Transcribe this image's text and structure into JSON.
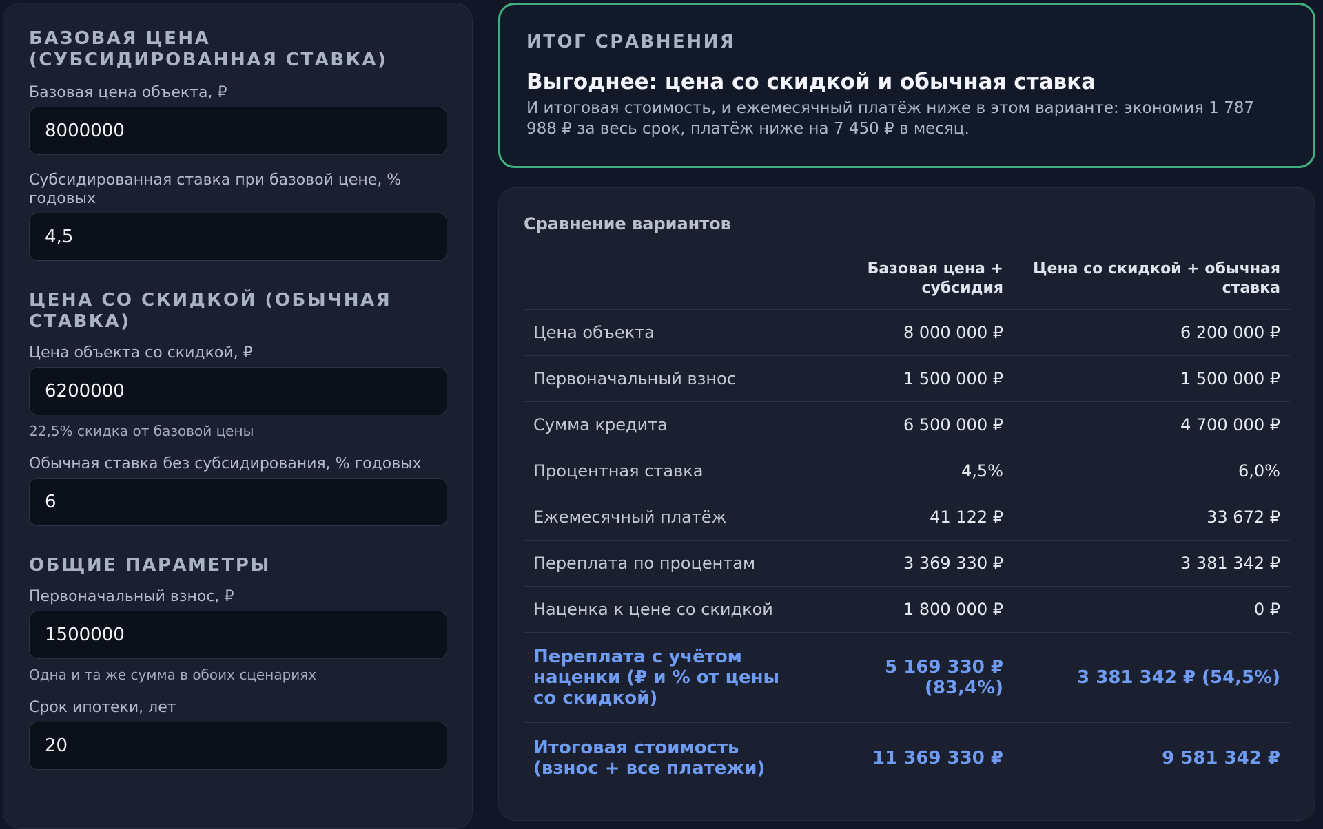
{
  "left": {
    "base_section_title": "БАЗОВАЯ ЦЕНА (СУБСИДИРОВАННАЯ СТАВКА)",
    "base_price_label": "Базовая цена объекта, ₽",
    "base_price_value": "8000000",
    "subsidized_rate_label": "Субсидированная ставка при базовой цене, % годовых",
    "subsidized_rate_value": "4,5",
    "discount_section_title": "ЦЕНА СО СКИДКОЙ (ОБЫЧНАЯ СТАВКА)",
    "discount_price_label": "Цена объекта со скидкой, ₽",
    "discount_price_value": "6200000",
    "discount_hint": "22,5% скидка от базовой цены",
    "regular_rate_label": "Обычная ставка без субсидирования, % годовых",
    "regular_rate_value": "6",
    "common_section_title": "ОБЩИЕ ПАРАМЕТРЫ",
    "down_payment_label": "Первоначальный взнос, ₽",
    "down_payment_value": "1500000",
    "down_payment_hint": "Одна и та же сумма в обоих сценариях",
    "term_label": "Срок ипотеки, лет",
    "term_value": "20"
  },
  "summary": {
    "heading": "ИТОГ СРАВНЕНИЯ",
    "verdict": "Выгоднее: цена со скидкой и обычная ставка",
    "text": "И итоговая стоимость, и ежемесячный платёж ниже в этом варианте: экономия 1 787 988 ₽ за весь срок, платёж ниже на 7 450 ₽ в месяц."
  },
  "comparison": {
    "title": "Сравнение вариантов",
    "col_a": "Базовая цена + субсидия",
    "col_b": "Цена со скидкой + обычная ставка",
    "rows": [
      {
        "label": "Цена объекта",
        "a": "8 000 000 ₽",
        "b": "6 200 000 ₽"
      },
      {
        "label": "Первоначальный взнос",
        "a": "1 500 000 ₽",
        "b": "1 500 000 ₽"
      },
      {
        "label": "Сумма кредита",
        "a": "6 500 000 ₽",
        "b": "4 700 000 ₽"
      },
      {
        "label": "Процентная ставка",
        "a": "4,5%",
        "b": "6,0%"
      },
      {
        "label": "Ежемесячный платёж",
        "a": "41 122 ₽",
        "b": "33 672 ₽"
      },
      {
        "label": "Переплата по процентам",
        "a": "3 369 330 ₽",
        "b": "3 381 342 ₽"
      },
      {
        "label": "Наценка к цене со скидкой",
        "a": "1 800 000 ₽",
        "b": "0 ₽"
      },
      {
        "label": "Переплата с учётом наценки (₽ и % от цены со скидкой)",
        "a": "5 169 330 ₽ (83,4%)",
        "b": "3 381 342 ₽ (54,5%)"
      },
      {
        "label": "Итоговая стоимость (взнос + все платежи)",
        "a": "11 369 330 ₽",
        "b": "9 581 342 ₽"
      }
    ]
  },
  "colors": {
    "background": "#111726",
    "panel": "#1a2030",
    "summary_border": "#3fae7d",
    "highlight_text": "#6f9cf2"
  }
}
